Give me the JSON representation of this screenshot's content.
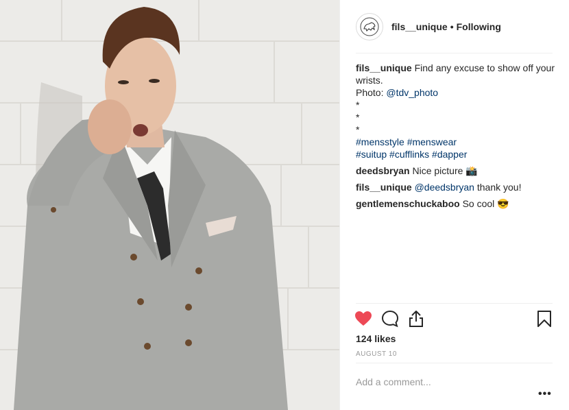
{
  "post": {
    "photo_alt": "Man in grey double-breasted suit",
    "header": {
      "username": "fils__unique",
      "separator": "•",
      "follow_state": "Following",
      "avatar_icon": "lion-crest-icon"
    },
    "caption": {
      "username": "fils__unique",
      "text": "Find any excuse to show off your wrists.",
      "photo_prefix": "Photo: ",
      "photo_credit": "@tdv_photo",
      "bullets": [
        "*",
        "*",
        "*"
      ],
      "hashtags_line1": "#mensstyle #menswear",
      "hashtags_line2": "#suitup #cufflinks #dapper"
    },
    "comments": [
      {
        "username": "deedsbryan",
        "text": "Nice picture 📸"
      },
      {
        "username": "fils__unique",
        "mention": "@deedsbryan",
        "text": " thank you!"
      },
      {
        "username": "gentlemenschuckaboo",
        "text": "So cool 😎"
      }
    ],
    "actions": {
      "like_icon": "heart-filled-icon",
      "comment_icon": "comment-bubble-icon",
      "share_icon": "share-icon",
      "save_icon": "bookmark-icon",
      "like_color": "#ed4956"
    },
    "likes": "124 likes",
    "date": "AUGUST 10",
    "add_comment_placeholder": "Add a comment...",
    "more_label": "•••"
  }
}
